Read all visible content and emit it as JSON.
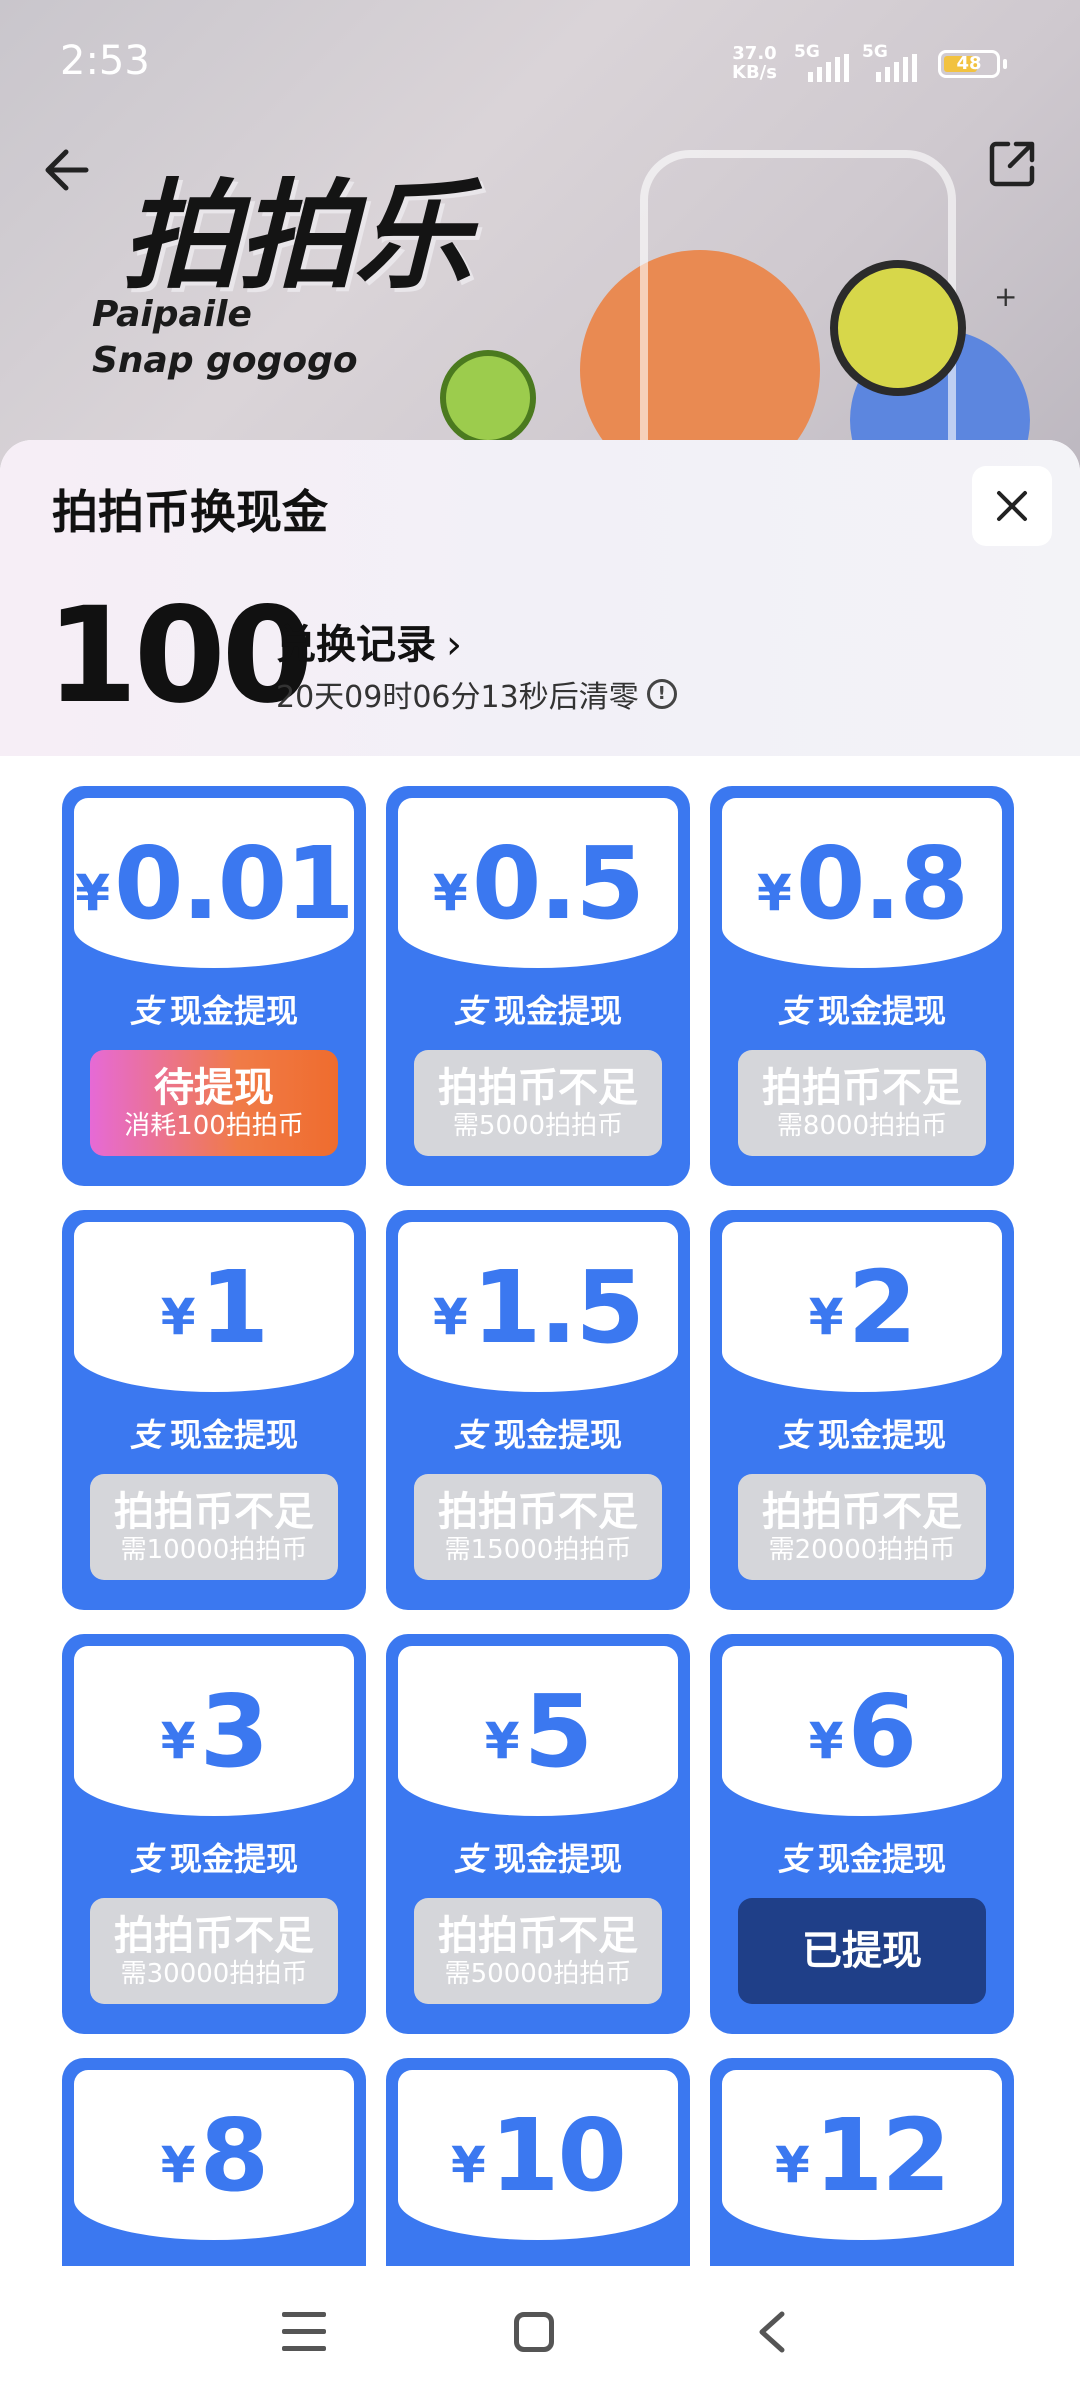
{
  "status_bar": {
    "time": "2:53",
    "net_speed_value": "37.0",
    "net_speed_unit": "KB/s",
    "sim1": "5G",
    "sim2": "5G",
    "battery": "48"
  },
  "banner": {
    "title": "拍拍乐",
    "subtitle_line1": "Paipaile",
    "subtitle_line2": "Snap gogogo",
    "icons": [
      "back-arrow-icon",
      "share-icon"
    ]
  },
  "sheet": {
    "title": "拍拍币换现金",
    "balance": "100",
    "records_label": "兑换记录",
    "records_chevron": "›",
    "countdown": "20天09时06分13秒后清零",
    "info_symbol": "!"
  },
  "cards": [
    {
      "currency": "¥",
      "amount": "0.01",
      "method": "现金提现",
      "button_main": "待提现",
      "button_sub": "消耗100拍拍币",
      "state": "active"
    },
    {
      "currency": "¥",
      "amount": "0.5",
      "method": "现金提现",
      "button_main": "拍拍币不足",
      "button_sub": "需5000拍拍币",
      "state": "insufficient"
    },
    {
      "currency": "¥",
      "amount": "0.8",
      "method": "现金提现",
      "button_main": "拍拍币不足",
      "button_sub": "需8000拍拍币",
      "state": "insufficient"
    },
    {
      "currency": "¥",
      "amount": "1",
      "method": "现金提现",
      "button_main": "拍拍币不足",
      "button_sub": "需10000拍拍币",
      "state": "insufficient"
    },
    {
      "currency": "¥",
      "amount": "1.5",
      "method": "现金提现",
      "button_main": "拍拍币不足",
      "button_sub": "需15000拍拍币",
      "state": "insufficient"
    },
    {
      "currency": "¥",
      "amount": "2",
      "method": "现金提现",
      "button_main": "拍拍币不足",
      "button_sub": "需20000拍拍币",
      "state": "insufficient"
    },
    {
      "currency": "¥",
      "amount": "3",
      "method": "现金提现",
      "button_main": "拍拍币不足",
      "button_sub": "需30000拍拍币",
      "state": "insufficient"
    },
    {
      "currency": "¥",
      "amount": "5",
      "method": "现金提现",
      "button_main": "拍拍币不足",
      "button_sub": "需50000拍拍币",
      "state": "insufficient"
    },
    {
      "currency": "¥",
      "amount": "6",
      "method": "现金提现",
      "button_main": "已提现",
      "button_sub": "",
      "state": "done"
    },
    {
      "currency": "¥",
      "amount": "8",
      "method": "",
      "button_main": "",
      "button_sub": "",
      "state": "partial"
    },
    {
      "currency": "¥",
      "amount": "10",
      "method": "",
      "button_main": "",
      "button_sub": "",
      "state": "partial"
    },
    {
      "currency": "¥",
      "amount": "12",
      "method": "",
      "button_main": "",
      "button_sub": "",
      "state": "partial"
    }
  ],
  "alipay_icon_glyph": "支",
  "colors": {
    "card_blue": "#3b78f0",
    "button_gradient_start": "#e66ad6",
    "button_gradient_end": "#ef6c2e",
    "insufficient_gray": "#d5d6da",
    "done_navy": "#1f3f88"
  },
  "navbar": {
    "icons": [
      "menu-icon",
      "home-square-icon",
      "back-chevron-icon"
    ]
  }
}
